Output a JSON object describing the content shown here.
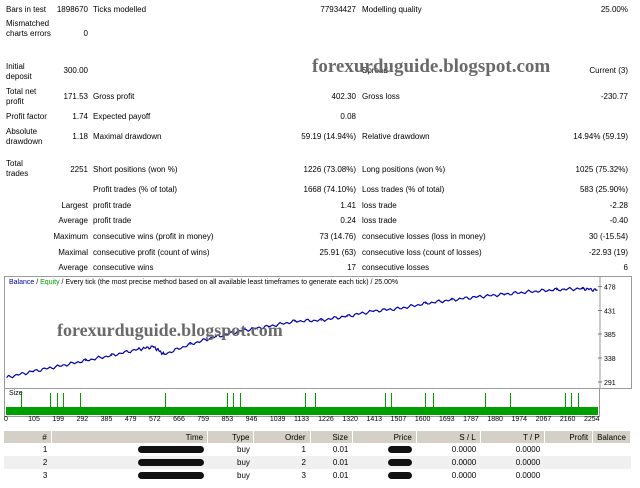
{
  "stats": {
    "bars_label": "Bars in test",
    "bars_value": "1898670",
    "ticks_label": "Ticks modelled",
    "ticks_value": "77934427",
    "quality_label": "Modelling quality",
    "quality_value": "25.00%",
    "mismatch_label": "Mismatched charts errors",
    "mismatch_value": "0",
    "deposit_label": "Initial deposit",
    "deposit_value": "300.00",
    "spread_label": "Spread",
    "spread_value": "Current (3)",
    "netprofit_label": "Total net profit",
    "netprofit_value": "171.53",
    "grossprofit_label": "Gross profit",
    "grossprofit_value": "402.30",
    "grossloss_label": "Gross loss",
    "grossloss_value": "-230.77",
    "pf_label": "Profit factor",
    "pf_value": "1.74",
    "payoff_label": "Expected payoff",
    "payoff_value": "0.08",
    "absdd_label": "Absolute drawdown",
    "absdd_value": "1.18",
    "maxdd_label": "Maximal drawdown",
    "maxdd_value": "59.19 (14.94%)",
    "reldd_label": "Relative drawdown",
    "reldd_value": "14.94% (59.19)",
    "trades_label": "Total trades",
    "trades_value": "2251",
    "short_label": "Short positions (won %)",
    "short_value": "1226 (73.08%)",
    "long_label": "Long positions (won %)",
    "long_value": "1025 (75.32%)",
    "ptrades_label": "Profit trades (% of total)",
    "ptrades_value": "1668 (74.10%)",
    "ltrades_label": "Loss trades (% of total)",
    "ltrades_value": "583 (25.90%)",
    "largest_label": "Largest",
    "largest_pt": "profit trade",
    "largest_pt_value": "1.41",
    "largest_lt": "loss trade",
    "largest_lt_value": "-2.28",
    "average_label": "Average",
    "average_pt": "profit trade",
    "average_pt_value": "0.24",
    "average_lt": "loss trade",
    "average_lt_value": "-0.40",
    "maxc_label": "Maximum",
    "maxc_w": "consecutive wins (profit in money)",
    "maxc_w_value": "73 (14.76)",
    "maxc_l": "consecutive losses (loss in money)",
    "maxc_l_value": "30 (-15.54)",
    "maxl_label": "Maximal",
    "maxl_w": "consecutive profit (count of wins)",
    "maxl_w_value": "25.91 (63)",
    "maxl_l": "consecutive loss (count of losses)",
    "maxl_l_value": "-22.93 (19)",
    "avgc_label": "Average",
    "avgc_w": "consecutive wins",
    "avgc_w_value": "17",
    "avgc_l": "consecutive losses",
    "avgc_l_value": "6"
  },
  "watermark": {
    "top": "forexurduguide.blogspot.com",
    "chart": "forexurduguide.blogspot.com"
  },
  "chart": {
    "legend_balance": "Balance",
    "legend_sep": " / ",
    "legend_equity": "Equity",
    "legend_rest": " / Every tick (the most precise method based on all available least timeframes to generate each tick) / 25.00%",
    "y_labels": [
      "478",
      "431",
      "385",
      "338",
      "291"
    ],
    "size_label": "Size",
    "x_labels": [
      "0",
      "105",
      "199",
      "292",
      "385",
      "479",
      "572",
      "666",
      "759",
      "853",
      "946",
      "1039",
      "1133",
      "1226",
      "1320",
      "1413",
      "1507",
      "1600",
      "1693",
      "1787",
      "1880",
      "1974",
      "2067",
      "2160",
      "2254"
    ],
    "balance_color": "#0000aa",
    "size_color": "#00a000"
  },
  "chart_data": {
    "type": "line",
    "x": [
      0,
      100,
      200,
      300,
      400,
      500,
      560,
      600,
      700,
      800,
      900,
      1000,
      1100,
      1200,
      1300,
      1400,
      1500,
      1600,
      1700,
      1800,
      1900,
      2000,
      2100,
      2200,
      2254
    ],
    "series": [
      {
        "name": "Balance",
        "values": [
          300,
          312,
          322,
          333,
          343,
          355,
          360,
          345,
          365,
          380,
          392,
          400,
          410,
          412,
          420,
          430,
          435,
          445,
          452,
          458,
          463,
          468,
          472,
          474,
          471
        ]
      }
    ],
    "ylim": [
      285,
      485
    ],
    "xlim": [
      0,
      2254
    ]
  },
  "table": {
    "columns": [
      "#",
      "Time",
      "Type",
      "Order",
      "Size",
      "Price",
      "S / L",
      "T / P",
      "Profit",
      "Balance"
    ],
    "rows": [
      {
        "n": "1",
        "type": "buy",
        "order": "1",
        "size": "0.01",
        "sl": "0.0000",
        "tp": "0.0000"
      },
      {
        "n": "2",
        "type": "buy",
        "order": "2",
        "size": "0.01",
        "sl": "0.0000",
        "tp": "0.0000"
      },
      {
        "n": "3",
        "type": "buy",
        "order": "3",
        "size": "0.01",
        "sl": "0.0000",
        "tp": "0.0000"
      }
    ]
  }
}
